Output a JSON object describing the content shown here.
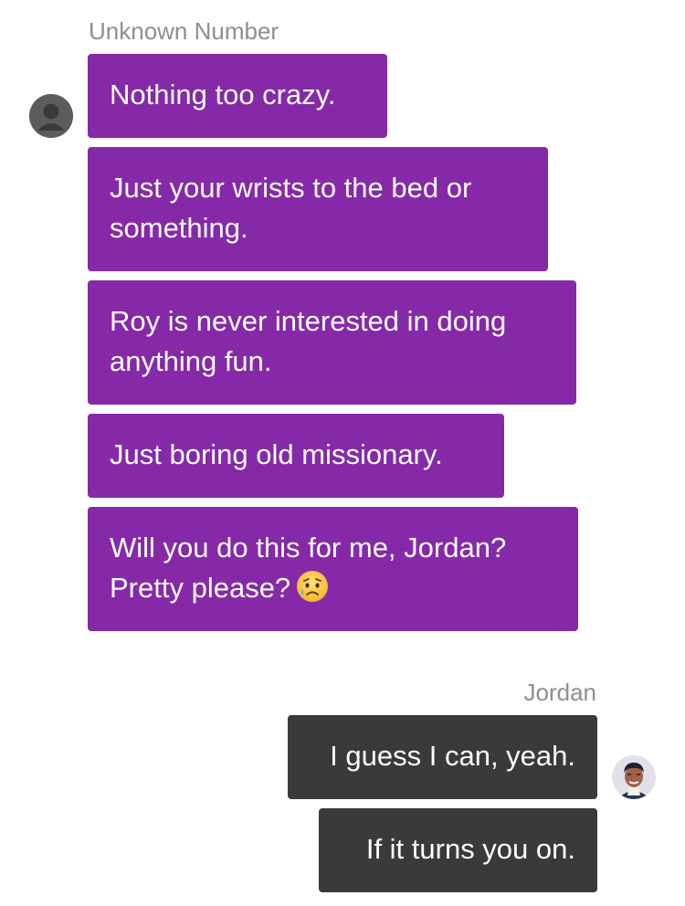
{
  "incoming": {
    "sender": "Unknown Number",
    "avatar_icon": "generic-person-icon",
    "color": "#8629a8",
    "messages": [
      {
        "lines": [
          "Nothing too crazy."
        ]
      },
      {
        "lines": [
          "Just your wrists to the bed or",
          "something."
        ]
      },
      {
        "lines": [
          "Roy is never interested in doing",
          "anything fun."
        ]
      },
      {
        "lines": [
          "Just boring old missionary."
        ]
      },
      {
        "lines": [
          "Will you do this for me, Jordan?",
          "Pretty please?"
        ],
        "emoji": "sad-but-relieved-face-icon"
      }
    ]
  },
  "outgoing": {
    "sender": "Jordan",
    "avatar_icon": "jordan-avatar",
    "color": "#3a3a3a",
    "messages": [
      {
        "lines": [
          "I guess I can, yeah."
        ]
      },
      {
        "lines": [
          "If it turns you on."
        ]
      }
    ]
  }
}
